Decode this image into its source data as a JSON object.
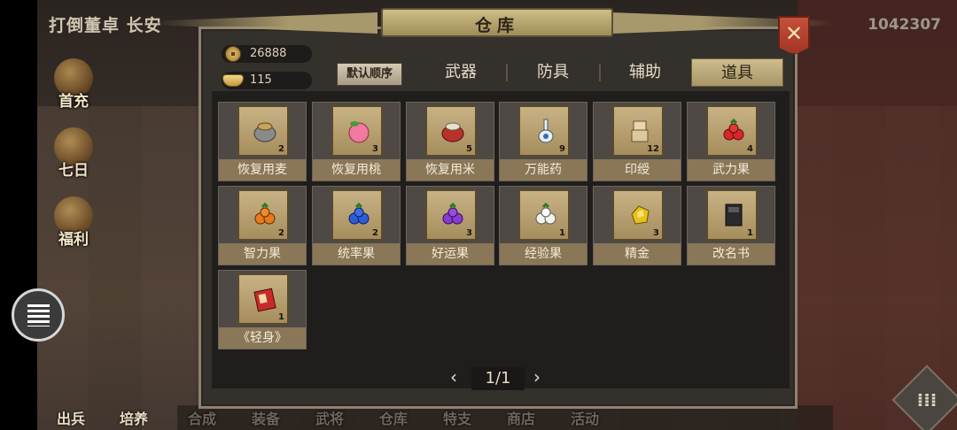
{
  "background": {
    "quest_title": "打倒董卓 长安",
    "power_value": "1042307",
    "side_buttons": [
      "首充",
      "七日",
      "福利"
    ],
    "bottom_nav": [
      "出兵",
      "培养",
      "合成",
      "装备",
      "武将",
      "仓库",
      "特支",
      "商店",
      "活动"
    ]
  },
  "panel": {
    "title": "仓库",
    "copper": "26888",
    "gold": "115",
    "sort_label": "默认顺序",
    "tabs": [
      {
        "label": "武器",
        "active": false
      },
      {
        "label": "防具",
        "active": false
      },
      {
        "label": "辅助",
        "active": false
      },
      {
        "label": "道具",
        "active": true
      }
    ],
    "items": [
      {
        "name": "恢复用麦",
        "count": "2",
        "icon": "grain-sack-icon"
      },
      {
        "name": "恢复用桃",
        "count": "3",
        "icon": "peach-icon"
      },
      {
        "name": "恢复用米",
        "count": "5",
        "icon": "rice-sack-icon"
      },
      {
        "name": "万能药",
        "count": "9",
        "icon": "medicine-vase-icon"
      },
      {
        "name": "印绶",
        "count": "12",
        "icon": "seal-icon"
      },
      {
        "name": "武力果",
        "count": "4",
        "icon": "red-fruit-icon"
      },
      {
        "name": "智力果",
        "count": "2",
        "icon": "orange-fruit-icon"
      },
      {
        "name": "统率果",
        "count": "2",
        "icon": "blue-fruit-icon"
      },
      {
        "name": "好运果",
        "count": "3",
        "icon": "purple-fruit-icon"
      },
      {
        "name": "经验果",
        "count": "1",
        "icon": "white-fruit-icon"
      },
      {
        "name": "精金",
        "count": "3",
        "icon": "gold-nugget-icon"
      },
      {
        "name": "改名书",
        "count": "1",
        "icon": "black-book-icon"
      },
      {
        "name": "《轻身》",
        "count": "1",
        "icon": "red-book-icon"
      }
    ],
    "pager": {
      "prev": "‹",
      "page": "1/1",
      "next": "›"
    }
  },
  "colors": {
    "panel_bg": "#34302c",
    "tab_active": "#cdbd8c",
    "close_red": "#c4503a"
  }
}
